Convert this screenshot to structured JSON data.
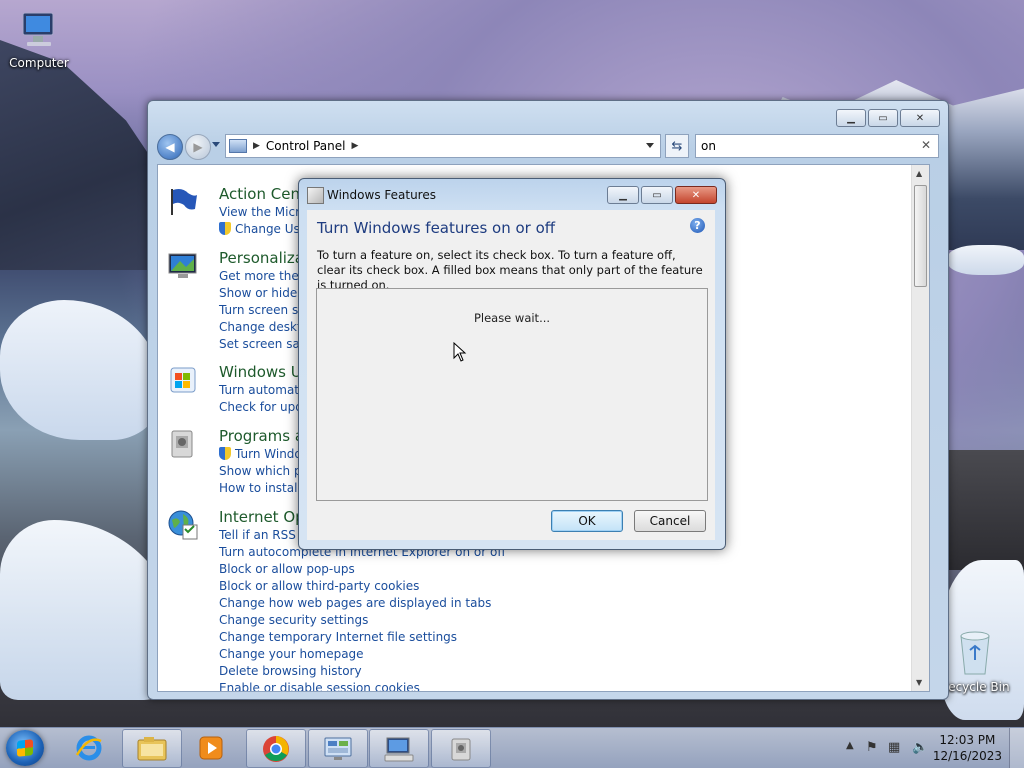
{
  "desktop": {
    "icons": [
      {
        "label": "Computer"
      },
      {
        "label": "Recycle Bin"
      }
    ]
  },
  "explorer": {
    "breadcrumb": [
      "Control Panel"
    ],
    "search_value": "on",
    "sections": [
      {
        "title": "Action Cent",
        "links": [
          "View the Micro",
          "Change Use"
        ],
        "icon": "flag-icon"
      },
      {
        "title": "Personaliza",
        "links": [
          "Get more them",
          "Show or hide c",
          "Turn screen sav",
          "Change deskto",
          "Set screen save"
        ],
        "icon": "monitor-icon"
      },
      {
        "title": "Windows U",
        "links": [
          "Turn automatic",
          "Check for upda"
        ],
        "icon": "windows-update-icon"
      },
      {
        "title": "Programs a",
        "links": [
          "Turn Windo",
          "Show which pr",
          "How to install a"
        ],
        "icon": "programs-icon"
      },
      {
        "title": "Internet Op",
        "links": [
          "Tell if an RSS fe",
          "Turn autocomplete in Internet Explorer on or off",
          "Block or allow pop-ups",
          "Block or allow third-party cookies",
          "Change how web pages are displayed in tabs",
          "Change security settings",
          "Change temporary Internet file settings",
          "Change your homepage",
          "Delete browsing history",
          "Enable or disable session cookies"
        ],
        "icon": "globe-icon"
      }
    ]
  },
  "dialog": {
    "title": "Windows Features",
    "heading": "Turn Windows features on or off",
    "description": "To turn a feature on, select its check box. To turn a feature off, clear its check box. A filled box means that only part of the feature is turned on.",
    "status": "Please wait...",
    "ok_label": "OK",
    "cancel_label": "Cancel",
    "help_glyph": "?"
  },
  "taskbar": {
    "time": "12:03 PM",
    "date": "12/16/2023",
    "pinned": [
      "internet-explorer-icon",
      "file-explorer-icon",
      "media-player-icon",
      "chrome-icon",
      "control-panel-icon",
      "remote-desktop-icon",
      "windows-features-icon"
    ]
  }
}
